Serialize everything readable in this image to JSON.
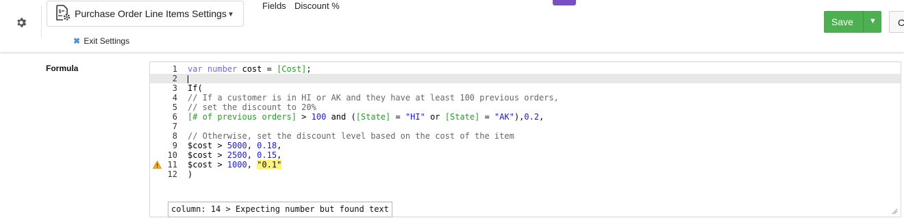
{
  "header": {
    "settings_title": "Purchase Order Line Items Settings",
    "exit_label": "Exit Settings",
    "tabs": [
      "Fields",
      "Discount %"
    ],
    "save_label": "Save",
    "cancel_label": "C"
  },
  "field": {
    "label": "Formula"
  },
  "editor": {
    "tooltip": "column: 14 > Expecting number but found text",
    "lines": [
      {
        "n": "1",
        "tokens": [
          [
            "type",
            "var "
          ],
          [
            "type",
            "number "
          ],
          [
            "kw",
            "cost = "
          ],
          [
            "field",
            "[Cost]"
          ],
          [
            "kw",
            ";"
          ]
        ]
      },
      {
        "n": "2",
        "tokens": []
      },
      {
        "n": "3",
        "tokens": [
          [
            "kw",
            "If("
          ]
        ]
      },
      {
        "n": "4",
        "tokens": [
          [
            "cmt",
            "// If a customer is in HI or AK and they have at least 100 previous orders,"
          ]
        ]
      },
      {
        "n": "5",
        "tokens": [
          [
            "cmt",
            "// set the discount to 20%"
          ]
        ]
      },
      {
        "n": "6",
        "tokens": [
          [
            "field",
            "[# of previous orders]"
          ],
          [
            "kw",
            " > "
          ],
          [
            "num",
            "100"
          ],
          [
            "kw",
            " and ("
          ],
          [
            "field",
            "[State]"
          ],
          [
            "kw",
            " = "
          ],
          [
            "str",
            "\"HI\""
          ],
          [
            "kw",
            " or "
          ],
          [
            "field",
            "[State]"
          ],
          [
            "kw",
            " = "
          ],
          [
            "str",
            "\"AK\""
          ],
          [
            "kw",
            "),"
          ],
          [
            "num",
            "0.2"
          ],
          [
            "kw",
            ","
          ]
        ]
      },
      {
        "n": "7",
        "tokens": []
      },
      {
        "n": "8",
        "tokens": [
          [
            "cmt",
            "// Otherwise, set the discount level based on the cost of the item"
          ]
        ]
      },
      {
        "n": "9",
        "tokens": [
          [
            "kw",
            "$cost > "
          ],
          [
            "num",
            "5000"
          ],
          [
            "kw",
            ", "
          ],
          [
            "num",
            "0.18"
          ],
          [
            "kw",
            ","
          ]
        ]
      },
      {
        "n": "10",
        "tokens": [
          [
            "kw",
            "$cost > "
          ],
          [
            "num",
            "2500"
          ],
          [
            "kw",
            ", "
          ],
          [
            "num",
            "0.15"
          ],
          [
            "kw",
            ","
          ]
        ]
      },
      {
        "n": "11",
        "tokens": [
          [
            "kw",
            "$cost > "
          ],
          [
            "num",
            "1000"
          ],
          [
            "kw",
            ", "
          ],
          [
            "hl",
            "\"0.1\""
          ]
        ]
      },
      {
        "n": "12",
        "tokens": [
          [
            "kw",
            ")"
          ]
        ]
      }
    ]
  }
}
